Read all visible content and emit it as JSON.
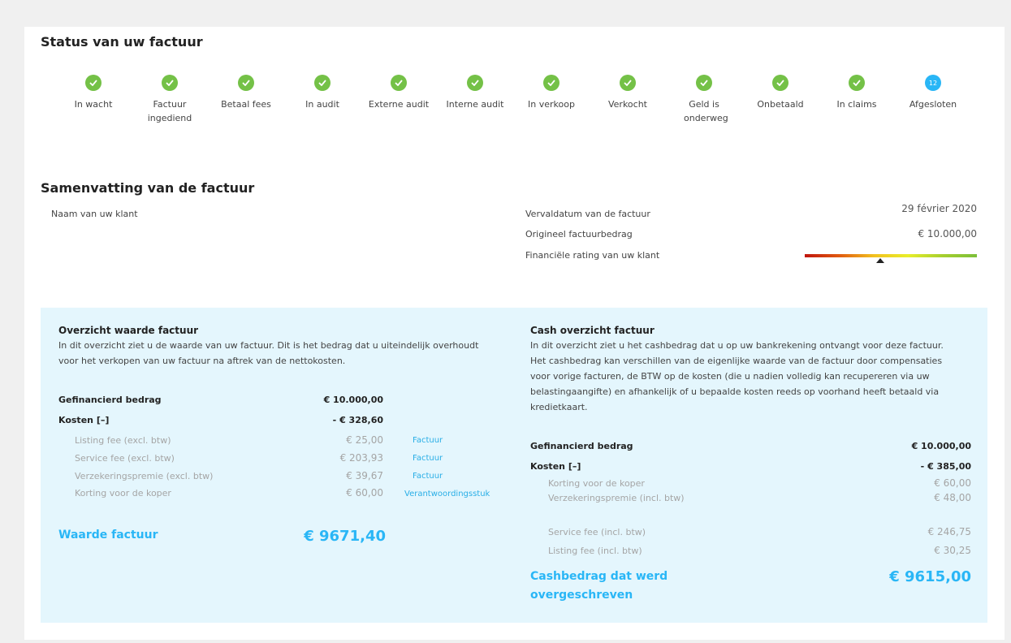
{
  "status": {
    "title": "Status van uw factuur",
    "steps": [
      {
        "label": "In wacht",
        "state": "done"
      },
      {
        "label": "Factuur ingediend",
        "state": "done"
      },
      {
        "label": "Betaal fees",
        "state": "done"
      },
      {
        "label": "In audit",
        "state": "done"
      },
      {
        "label": "Externe audit",
        "state": "done"
      },
      {
        "label": "Interne audit",
        "state": "done"
      },
      {
        "label": "In verkoop",
        "state": "done"
      },
      {
        "label": "Verkocht",
        "state": "done"
      },
      {
        "label": "Geld is onderweg",
        "state": "done"
      },
      {
        "label": "Onbetaald",
        "state": "done"
      },
      {
        "label": "In claims",
        "state": "done"
      },
      {
        "label": "Afgesloten",
        "state": "current",
        "badge": "12"
      }
    ],
    "colors": {
      "done": "#74c147",
      "current": "#29b6f6"
    }
  },
  "summary": {
    "title": "Samenvatting van de factuur",
    "client_label": "Naam van uw klant",
    "due_label": "Vervaldatum van de factuur",
    "due_value": "29 février 2020",
    "amount_label": "Origineel factuurbedrag",
    "amount_value": "€ 10.000,00",
    "rating_label": "Financiële rating van uw klant",
    "rating_level": 0.44
  },
  "overview": {
    "title": "Overzicht waarde factuur",
    "text_line1": "In dit overzicht ziet u de waarde van uw factuur. Dit is het bedrag dat u uiteindelijk overhoudt",
    "text_line2": "voor het verkopen van uw factuur na aftrek van de nettokosten.",
    "financed_label": "Gefinancierd bedrag",
    "financed_value": "€ 10.000,00",
    "costs_label": "Kosten [–]",
    "costs_value": "- € 328,60",
    "items": [
      {
        "label": "Listing fee (excl. btw)",
        "value": "€ 25,00",
        "link": "Factuur"
      },
      {
        "label": "Service fee (excl. btw)",
        "value": "€ 203,93",
        "link": "Factuur"
      },
      {
        "label": "Verzekeringspremie (excl. btw)",
        "value": "€ 39,67",
        "link": "Factuur"
      },
      {
        "label": "Korting voor de koper",
        "value": "€ 60,00",
        "link": "Verantwoordingsstuk"
      }
    ],
    "total_label": "Waarde factuur",
    "total_value": "€ 9671,40"
  },
  "cash": {
    "title": "Cash overzicht factuur",
    "text_lines": [
      "In dit overzicht ziet u het cashbedrag dat u op uw bankrekening ontvangt voor deze factuur.",
      "Het cashbedrag kan verschillen van de eigenlijke waarde van de factuur door compensaties",
      "voor vorige facturen, de BTW op de kosten (die u nadien volledig kan recupereren via uw",
      "belastingaangifte) en afhankelijk of u bepaalde kosten reeds op voorhand heeft betaald via",
      "kredietkaart."
    ],
    "financed_label": "Gefinancierd bedrag",
    "financed_value": "€ 10.000,00",
    "costs_label": "Kosten [–]",
    "costs_value": "- € 385,00",
    "items": [
      {
        "label": "Korting voor de koper",
        "value": "€ 60,00"
      },
      {
        "label": "Verzekeringspremie (incl. btw)",
        "value": "€ 48,00"
      },
      {
        "label": "Service fee (incl. btw)",
        "value": "€ 246,75"
      },
      {
        "label": "Listing fee (incl. btw)",
        "value": "€ 30,25"
      }
    ],
    "total_label_line1": "Cashbedrag dat werd",
    "total_label_line2": "overgeschreven",
    "total_value": "€ 9615,00"
  }
}
